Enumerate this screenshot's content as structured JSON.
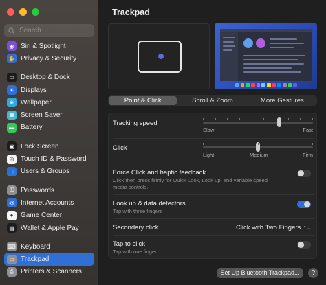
{
  "sidebar": {
    "search_placeholder": "Search",
    "items": [
      {
        "label": "Siri & Spotlight",
        "icon": "siri-icon",
        "color": "#7b4fd6",
        "glyph": "◉"
      },
      {
        "label": "Privacy & Security",
        "icon": "hand-icon",
        "color": "#2f6fd6",
        "glyph": "✋"
      },
      {
        "label": "Desktop & Dock",
        "icon": "dock-icon",
        "color": "#1c1c1c",
        "glyph": "▭"
      },
      {
        "label": "Displays",
        "icon": "display-icon",
        "color": "#2f6fd6",
        "glyph": "☀"
      },
      {
        "label": "Wallpaper",
        "icon": "wallpaper-icon",
        "color": "#31a8e0",
        "glyph": "❀"
      },
      {
        "label": "Screen Saver",
        "icon": "screensaver-icon",
        "color": "#41b8d8",
        "glyph": "▦"
      },
      {
        "label": "Battery",
        "icon": "battery-icon",
        "color": "#34c759",
        "glyph": "▬"
      },
      {
        "label": "Lock Screen",
        "icon": "lock-icon",
        "color": "#1c1c1c",
        "glyph": "▣"
      },
      {
        "label": "Touch ID & Password",
        "icon": "fingerprint-icon",
        "color": "#f5f5f5",
        "glyph": "◎"
      },
      {
        "label": "Users & Groups",
        "icon": "users-icon",
        "color": "#2f6fd6",
        "glyph": "👥"
      },
      {
        "label": "Passwords",
        "icon": "key-icon",
        "color": "#8e8e93",
        "glyph": "⚿"
      },
      {
        "label": "Internet Accounts",
        "icon": "at-icon",
        "color": "#2f6fd6",
        "glyph": "@"
      },
      {
        "label": "Game Center",
        "icon": "gamecenter-icon",
        "color": "#f5f5f5",
        "glyph": "●"
      },
      {
        "label": "Wallet & Apple Pay",
        "icon": "wallet-icon",
        "color": "#1c1c1c",
        "glyph": "▤"
      },
      {
        "label": "Keyboard",
        "icon": "keyboard-icon",
        "color": "#8e8e93",
        "glyph": "⌨"
      },
      {
        "label": "Trackpad",
        "icon": "trackpad-icon",
        "color": "#8e8e93",
        "glyph": "▭"
      },
      {
        "label": "Printers & Scanners",
        "icon": "printer-icon",
        "color": "#8e8e93",
        "glyph": "⎙"
      }
    ]
  },
  "main": {
    "title": "Trackpad",
    "tabs": [
      "Point & Click",
      "Scroll & Zoom",
      "More Gestures"
    ],
    "active_tab": 0,
    "tracking": {
      "label": "Tracking speed",
      "min_label": "Slow",
      "max_label": "Fast",
      "value": 0.7
    },
    "click": {
      "label": "Click",
      "labels": [
        "Light",
        "Medium",
        "Firm"
      ],
      "value": 0.5
    },
    "force_click": {
      "label": "Force Click and haptic feedback",
      "desc": "Click then press firmly for Quick Look, Look up, and variable speed media controls.",
      "on": false
    },
    "lookup": {
      "label": "Look up & data detectors",
      "desc": "Tap with three fingers",
      "on": true
    },
    "secondary": {
      "label": "Secondary click",
      "value": "Click with Two Fingers"
    },
    "tap": {
      "label": "Tap to click",
      "desc": "Tap with one finger",
      "on": false
    },
    "bt_button": "Set Up Bluetooth Trackpad...",
    "help": "?"
  }
}
